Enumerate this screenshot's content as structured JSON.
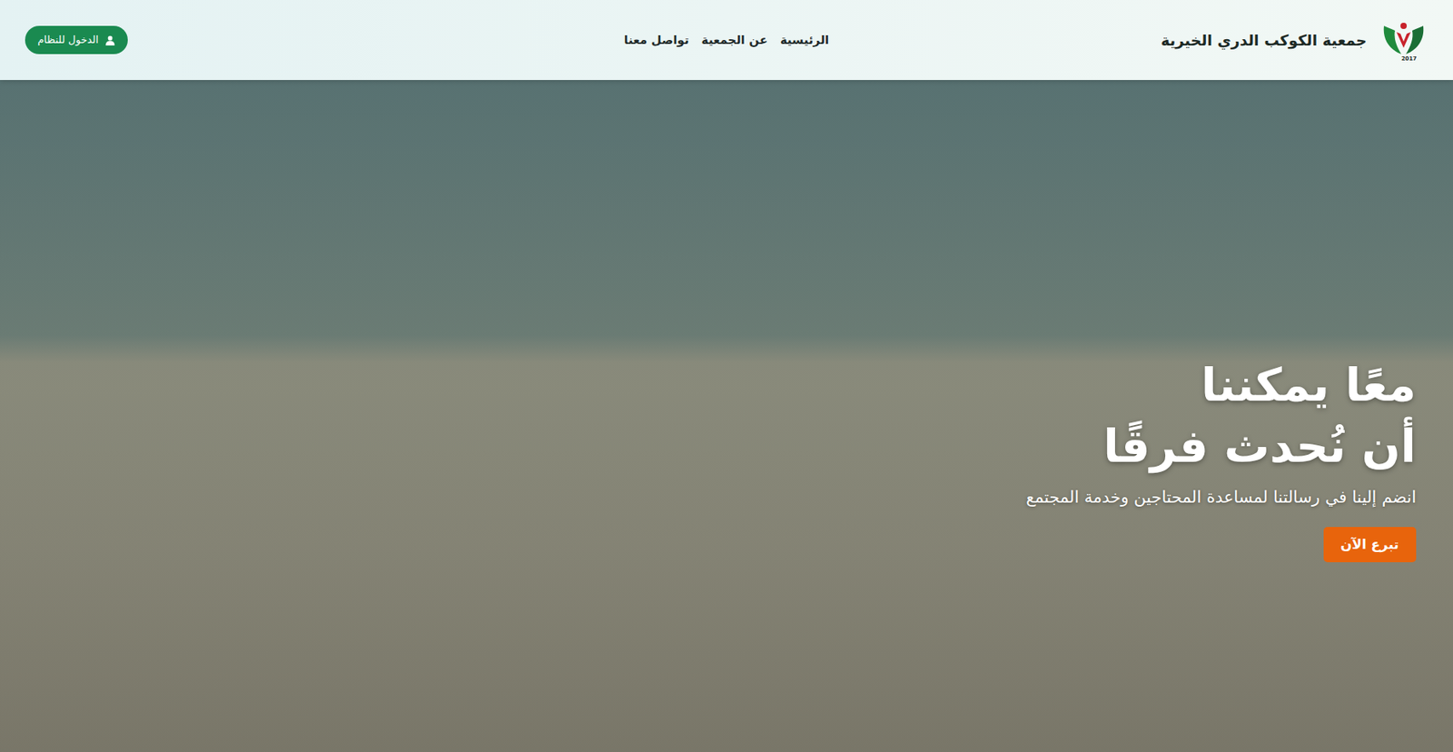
{
  "brand": {
    "name": "جمعية الكوكب الدري الخيرية",
    "logo_year": "2017"
  },
  "nav": {
    "links": [
      {
        "label": "الرئيسية"
      },
      {
        "label": "عن الجمعية"
      },
      {
        "label": "تواصل معنا"
      }
    ]
  },
  "login_button": {
    "label": "الدخول للنظام"
  },
  "hero": {
    "title_lines": [
      "معًا يمكننا",
      "أن نُحدث فرقًا"
    ],
    "subtitle": "انضم إلينا في رسالتنا لمساعدة المحتاجين وخدمة المجتمع",
    "button": "تبرع الآن"
  }
}
